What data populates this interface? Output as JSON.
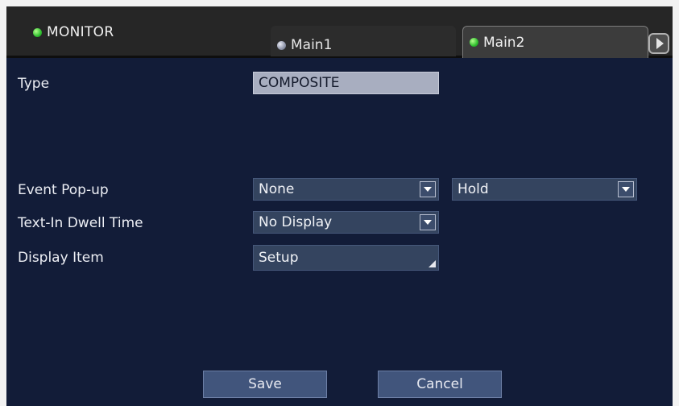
{
  "header": {
    "title": "MONITOR",
    "tabs": [
      {
        "label": "Main1",
        "led": "grey",
        "selected": false
      },
      {
        "label": "Main2",
        "led": "green",
        "selected": true
      }
    ],
    "next_icon": "chevron-right-icon"
  },
  "form": {
    "type": {
      "label": "Type",
      "value": "COMPOSITE"
    },
    "event_popup": {
      "label": "Event Pop-up",
      "value": "None",
      "value2": "Hold"
    },
    "text_in_dwell": {
      "label": "Text-In Dwell Time",
      "value": "No Display"
    },
    "display_item": {
      "label": "Display Item",
      "value": "Setup"
    }
  },
  "footer": {
    "save_label": "Save",
    "cancel_label": "Cancel"
  },
  "colors": {
    "background": "#121c38",
    "titlebar": "#262626",
    "field": "#34445f",
    "button": "#41557c",
    "led_active": "#2fbf2f"
  }
}
